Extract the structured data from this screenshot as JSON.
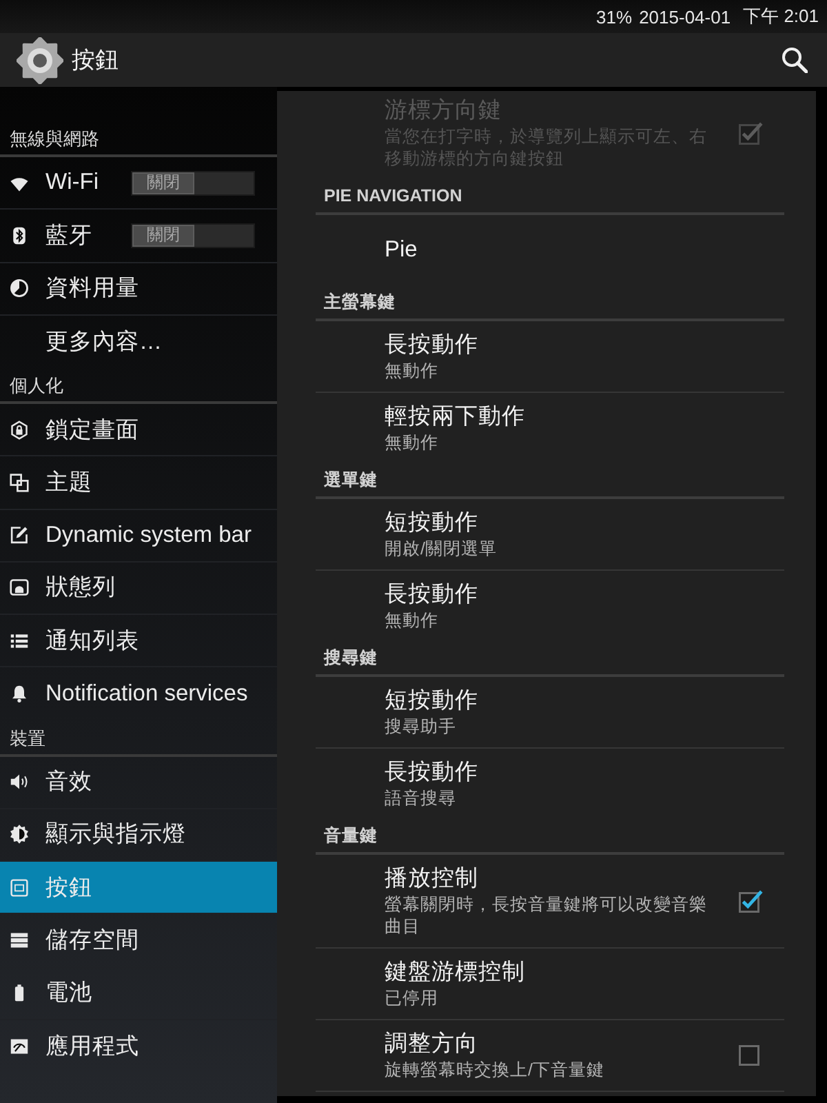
{
  "status_bar": {
    "battery": "31%",
    "date": "2015-04-01",
    "time": "下午 2:01"
  },
  "action_bar": {
    "title": "按鈕"
  },
  "sidebar": {
    "sections": [
      {
        "header": "無線與網路",
        "items": [
          {
            "label": "Wi-Fi",
            "selected": false,
            "toggle": {
              "label": "關閉",
              "on": false
            }
          },
          {
            "label": "藍牙",
            "selected": false,
            "toggle": {
              "label": "關閉",
              "on": false
            }
          },
          {
            "label": "資料用量",
            "selected": false
          },
          {
            "label": "更多內容…",
            "selected": false
          }
        ]
      },
      {
        "header": "個人化",
        "items": [
          {
            "label": "鎖定畫面",
            "selected": false
          },
          {
            "label": "主題",
            "selected": false
          },
          {
            "label": "Dynamic system bar",
            "selected": false
          },
          {
            "label": "狀態列",
            "selected": false
          },
          {
            "label": "通知列表",
            "selected": false
          },
          {
            "label": "Notification services",
            "selected": false
          }
        ]
      },
      {
        "header": "裝置",
        "items": [
          {
            "label": "音效",
            "selected": false
          },
          {
            "label": "顯示與指示燈",
            "selected": false
          },
          {
            "label": "按鈕",
            "selected": true
          },
          {
            "label": "儲存空間",
            "selected": false
          },
          {
            "label": "電池",
            "selected": false
          },
          {
            "label": "應用程式",
            "selected": false
          }
        ]
      }
    ]
  },
  "preferences": {
    "groups": [
      {
        "items": [
          {
            "title": "游標方向鍵",
            "summary": "當您在打字時，於導覽列上顯示可左、右移動游標的方向鍵按鈕",
            "disabled": true,
            "checkbox": {
              "checked": true
            }
          }
        ]
      },
      {
        "header": "PIE NAVIGATION",
        "items": [
          {
            "title": "Pie",
            "disabled": false
          }
        ]
      },
      {
        "header": "主螢幕鍵",
        "items": [
          {
            "title": "長按動作",
            "summary": "無動作",
            "disabled": false
          },
          {
            "title": "輕按兩下動作",
            "summary": "無動作",
            "disabled": false
          }
        ]
      },
      {
        "header": "選單鍵",
        "items": [
          {
            "title": "短按動作",
            "summary": "開啟/關閉選單",
            "disabled": false
          },
          {
            "title": "長按動作",
            "summary": "無動作",
            "disabled": false
          }
        ]
      },
      {
        "header": "搜尋鍵",
        "items": [
          {
            "title": "短按動作",
            "summary": "搜尋助手",
            "disabled": false
          },
          {
            "title": "長按動作",
            "summary": "語音搜尋",
            "disabled": false
          }
        ]
      },
      {
        "header": "音量鍵",
        "items": [
          {
            "title": "播放控制",
            "summary": "螢幕關閉時，長按音量鍵將可以改變音樂曲目",
            "disabled": false,
            "checkbox": {
              "checked": true
            }
          },
          {
            "title": "鍵盤游標控制",
            "summary": "已停用",
            "disabled": false
          },
          {
            "title": "調整方向",
            "summary": "旋轉螢幕時交換上/下音量鍵",
            "disabled": false,
            "checkbox": {
              "checked": false
            }
          }
        ]
      }
    ]
  }
}
